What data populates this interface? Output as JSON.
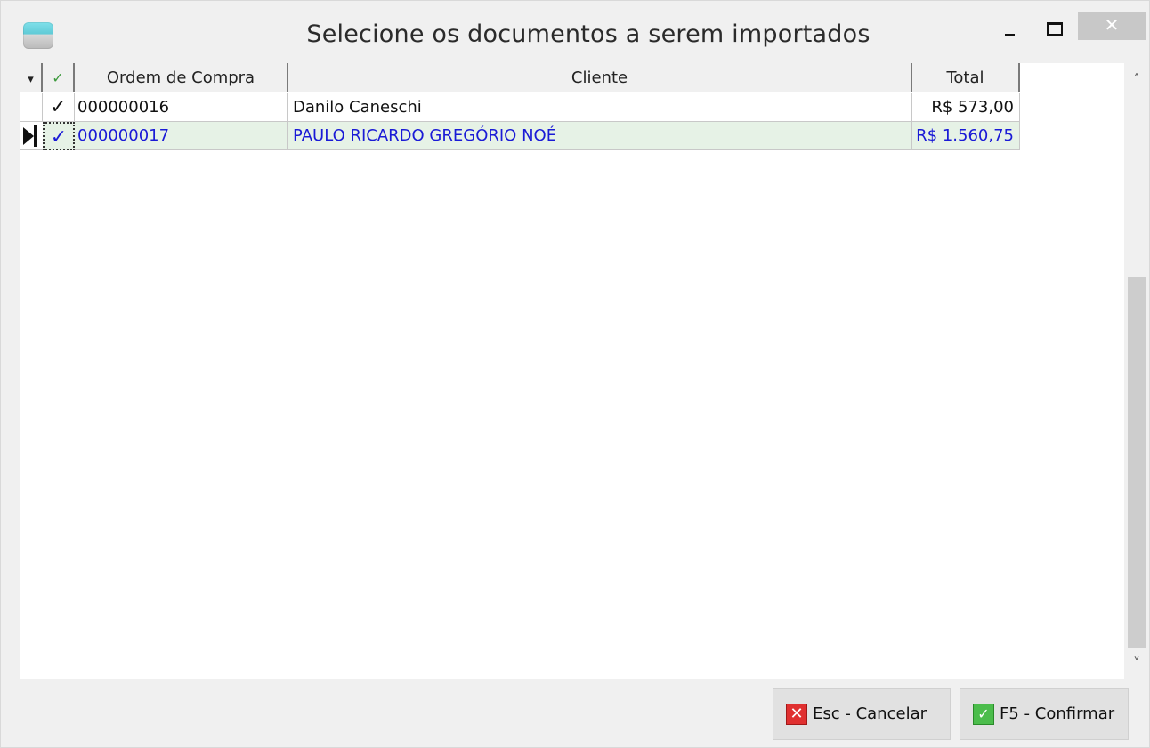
{
  "window": {
    "title": "Selecione os documentos a serem importados",
    "close_glyph": "✕"
  },
  "grid": {
    "indicator_header": "▾",
    "check_header": "✓",
    "columns": [
      "Ordem de Compra",
      "Cliente",
      "Total"
    ],
    "rows": [
      {
        "checked": "✓",
        "ordem": "000000016",
        "cliente": "Danilo Caneschi",
        "total": "R$ 573,00"
      },
      {
        "checked": "✓",
        "ordem": "000000017",
        "cliente": "PAULO RICARDO GREGÓRIO NOÉ",
        "total": "R$ 1.560,75"
      }
    ]
  },
  "scrollbar": {
    "up": "˄",
    "down": "˅"
  },
  "footer": {
    "cancel_label": "Esc - Cancelar",
    "confirm_label": "F5 - Confirmar"
  },
  "colors": {
    "selected_text": "#1a1ad6",
    "selected_row_bg": "#e6f2e6",
    "check": "#1f8f1f"
  }
}
